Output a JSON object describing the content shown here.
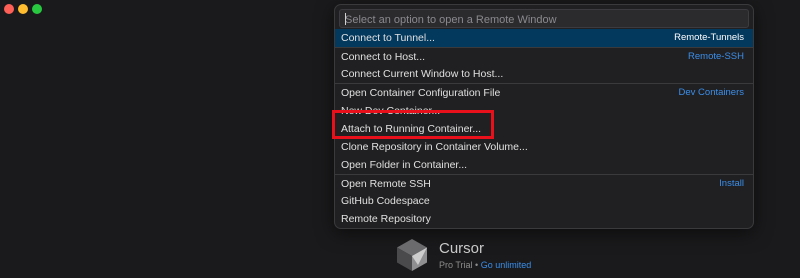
{
  "search": {
    "placeholder": "Select an option to open a Remote Window"
  },
  "items": [
    {
      "label": "Connect to Tunnel...",
      "tag": "Remote-Tunnels"
    },
    {
      "label": "Connect to Host...",
      "tag": "Remote-SSH"
    },
    {
      "label": "Connect Current Window to Host...",
      "tag": ""
    },
    {
      "label": "Open Container Configuration File",
      "tag": "Dev Containers"
    },
    {
      "label": "New Dev Container...",
      "tag": ""
    },
    {
      "label": "Attach to Running Container...",
      "tag": ""
    },
    {
      "label": "Clone Repository in Container Volume...",
      "tag": ""
    },
    {
      "label": "Open Folder in Container...",
      "tag": ""
    },
    {
      "label": "Open Remote SSH",
      "tag": "Install"
    },
    {
      "label": "GitHub Codespace",
      "tag": ""
    },
    {
      "label": "Remote Repository",
      "tag": ""
    }
  ],
  "brand": {
    "name": "Cursor",
    "plan": "Pro Trial",
    "separator": "•",
    "link": "Go unlimited",
    "logo_icon": "cursor-cube-icon"
  },
  "colors": {
    "background": "#1a1a1c",
    "palette": "#202022",
    "selected": "#04395e",
    "link": "#3b8eea",
    "annotation": "#e8101a"
  }
}
